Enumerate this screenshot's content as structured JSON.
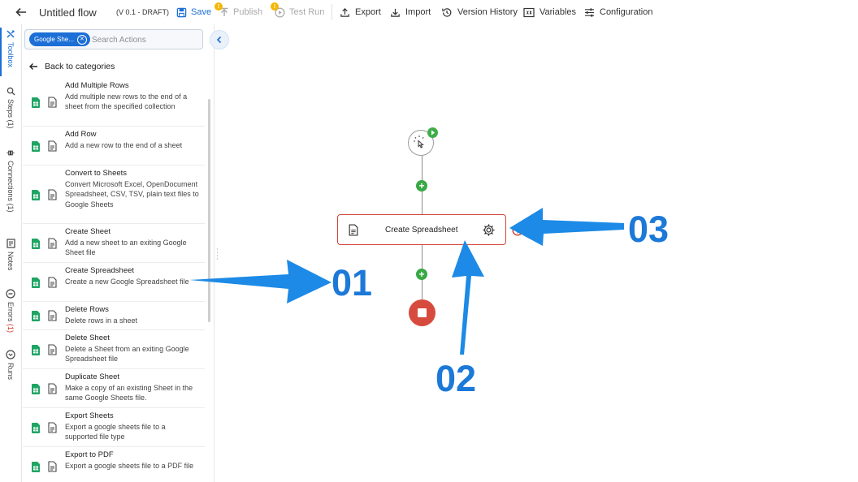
{
  "header": {
    "title": "Untitled flow",
    "version": "(V 0.1 - DRAFT)",
    "save_label": "Save",
    "publish_label": "Publish",
    "publish_badge": "!",
    "test_run_label": "Test Run",
    "test_run_badge": "!",
    "export_label": "Export",
    "import_label": "Import",
    "version_history_label": "Version History",
    "variables_label": "Variables",
    "configuration_label": "Configuration"
  },
  "rail": {
    "tabs": [
      {
        "label": "Toolbox",
        "count": "",
        "icon": "tools-icon",
        "active": true
      },
      {
        "label": "Steps",
        "count": "(1)",
        "icon": "search-icon"
      },
      {
        "label": "Connections",
        "count": "(1)",
        "icon": "plug-icon"
      },
      {
        "label": "Notes",
        "count": "",
        "icon": "note-icon"
      },
      {
        "label": "Errors",
        "count": "(1)",
        "icon": "minus-circle-icon"
      },
      {
        "label": "Runs",
        "count": "",
        "icon": "chevron-circle-icon"
      }
    ]
  },
  "panel": {
    "filter_chip": "Google She...",
    "search_placeholder": "Search Actions",
    "back_label": "Back to categories",
    "actions": [
      {
        "title": "Add Multiple Rows",
        "desc": "Add multiple new rows to the end of a sheet from the specified collection"
      },
      {
        "title": "Add Row",
        "desc": "Add a new row to the end of a sheet"
      },
      {
        "title": "Convert to Sheets",
        "desc": "Convert Microsoft Excel, OpenDocument Spreadsheet, CSV, TSV, plain text files to Google Sheets"
      },
      {
        "title": "Create Sheet",
        "desc": "Add a new sheet to an exiting Google Sheet file"
      },
      {
        "title": "Create Spreadsheet",
        "desc": "Create a new Google Spreadsheet file"
      },
      {
        "title": "Delete Rows",
        "desc": "Delete rows in a sheet"
      },
      {
        "title": "Delete Sheet",
        "desc": "Delete a Sheet from an exiting Google Spreadsheet file"
      },
      {
        "title": "Duplicate Sheet",
        "desc": "Make a copy of an existing Sheet in the same Google Sheets file."
      },
      {
        "title": "Export Sheets",
        "desc": "Export a google sheets file to a supported file type"
      },
      {
        "title": "Export to PDF",
        "desc": "Export a google sheets file to a PDF file"
      }
    ]
  },
  "canvas": {
    "step_label": "Create Spreadsheet",
    "callouts": {
      "c1": "01",
      "c2": "02",
      "c3": "03"
    }
  },
  "colors": {
    "accent": "#1c6fd6",
    "callout": "#1c79d8",
    "add_button": "#39a845",
    "error": "#d64b3d",
    "sheets_green": "#1fa463"
  }
}
